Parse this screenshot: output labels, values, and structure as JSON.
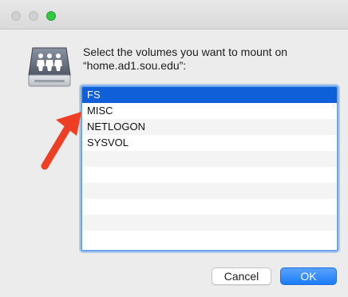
{
  "dialog": {
    "prompt_line1": "Select the volumes you want to mount on",
    "prompt_line2": "“home.ad1.sou.edu”:"
  },
  "volumes": {
    "items": [
      {
        "label": "FS",
        "selected": true
      },
      {
        "label": "MISC",
        "selected": false
      },
      {
        "label": "NETLOGON",
        "selected": false
      },
      {
        "label": "SYSVOL",
        "selected": false
      }
    ],
    "empty_rows": 6
  },
  "buttons": {
    "cancel_label": "Cancel",
    "ok_label": "OK"
  },
  "colors": {
    "selection": "#0e5fd8",
    "ok_button": "#1b7cf5",
    "annotation_arrow": "#ee3f24",
    "zoom_button": "#2fc840"
  },
  "icons": {
    "server": "shared-server-icon",
    "annotation": "red-arrow-annotation"
  }
}
